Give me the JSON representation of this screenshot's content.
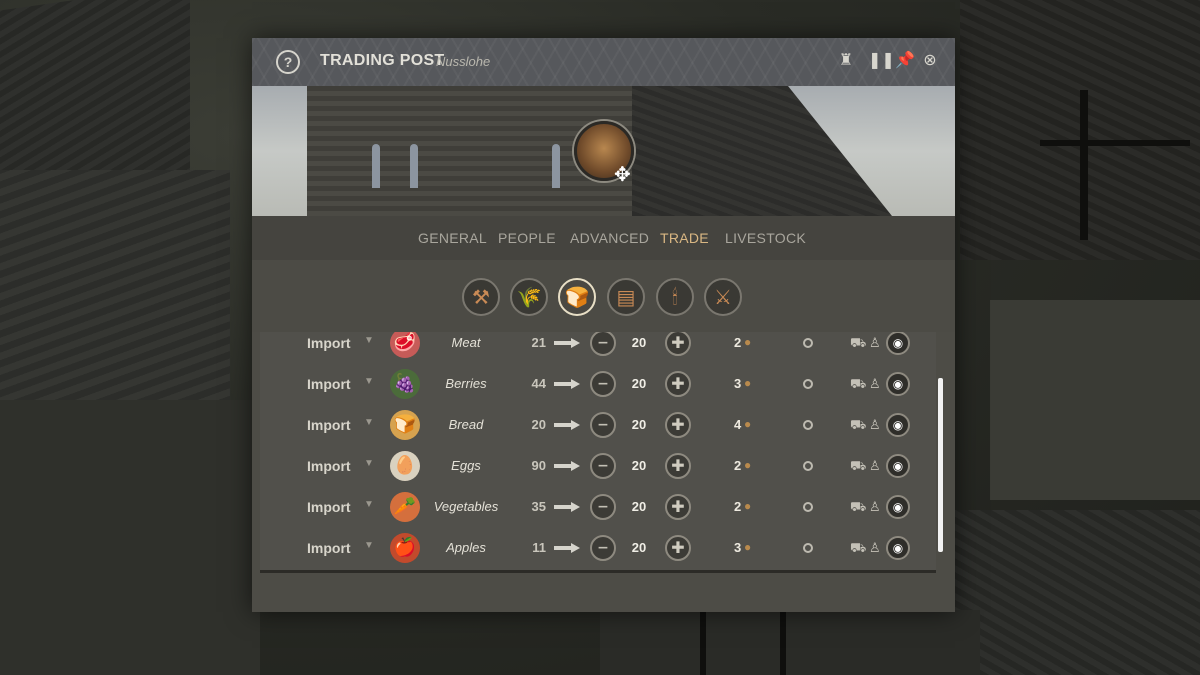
{
  "window": {
    "title": "TRADING POST",
    "subtitle": "Nusslohe",
    "help_label": "?"
  },
  "titlebar_icons": [
    "castle-icon",
    "pause-icon",
    "pin-icon",
    "close-icon"
  ],
  "tabs": [
    {
      "label": "GENERAL",
      "active": false
    },
    {
      "label": "PEOPLE",
      "active": false
    },
    {
      "label": "ADVANCED",
      "active": false
    },
    {
      "label": "TRADE",
      "active": true
    },
    {
      "label": "LIVESTOCK",
      "active": false
    }
  ],
  "categories": [
    {
      "icon": "materials-icon",
      "glyph": "⚒",
      "active": false
    },
    {
      "icon": "grain-icon",
      "glyph": "🌾",
      "active": false
    },
    {
      "icon": "food-icon",
      "glyph": "🍞",
      "active": true
    },
    {
      "icon": "leather-icon",
      "glyph": "▤",
      "active": false
    },
    {
      "icon": "candle-icon",
      "glyph": "🕯",
      "active": false
    },
    {
      "icon": "tools-icon",
      "glyph": "⚔",
      "active": false
    }
  ],
  "rows": [
    {
      "mode": "Import",
      "good": "Meat",
      "glyph": "🥩",
      "glyph_bg": "#c65b58",
      "stock": "21",
      "target": "20",
      "price": "2"
    },
    {
      "mode": "Import",
      "good": "Berries",
      "glyph": "🍇",
      "glyph_bg": "#4b6b3a",
      "stock": "44",
      "target": "20",
      "price": "3"
    },
    {
      "mode": "Import",
      "good": "Bread",
      "glyph": "🍞",
      "glyph_bg": "#d6a24f",
      "stock": "20",
      "target": "20",
      "price": "4"
    },
    {
      "mode": "Import",
      "good": "Eggs",
      "glyph": "🥚",
      "glyph_bg": "#d9d1bf",
      "stock": "90",
      "target": "20",
      "price": "2"
    },
    {
      "mode": "Import",
      "good": "Vegetables",
      "glyph": "🥕",
      "glyph_bg": "#d46f3d",
      "stock": "35",
      "target": "20",
      "price": "2"
    },
    {
      "mode": "Import",
      "good": "Apples",
      "glyph": "🍎",
      "glyph_bg": "#c24a2c",
      "stock": "11",
      "target": "20",
      "price": "3"
    }
  ],
  "colors": {
    "accent": "#d9b783",
    "panel": "#4d4c46"
  }
}
